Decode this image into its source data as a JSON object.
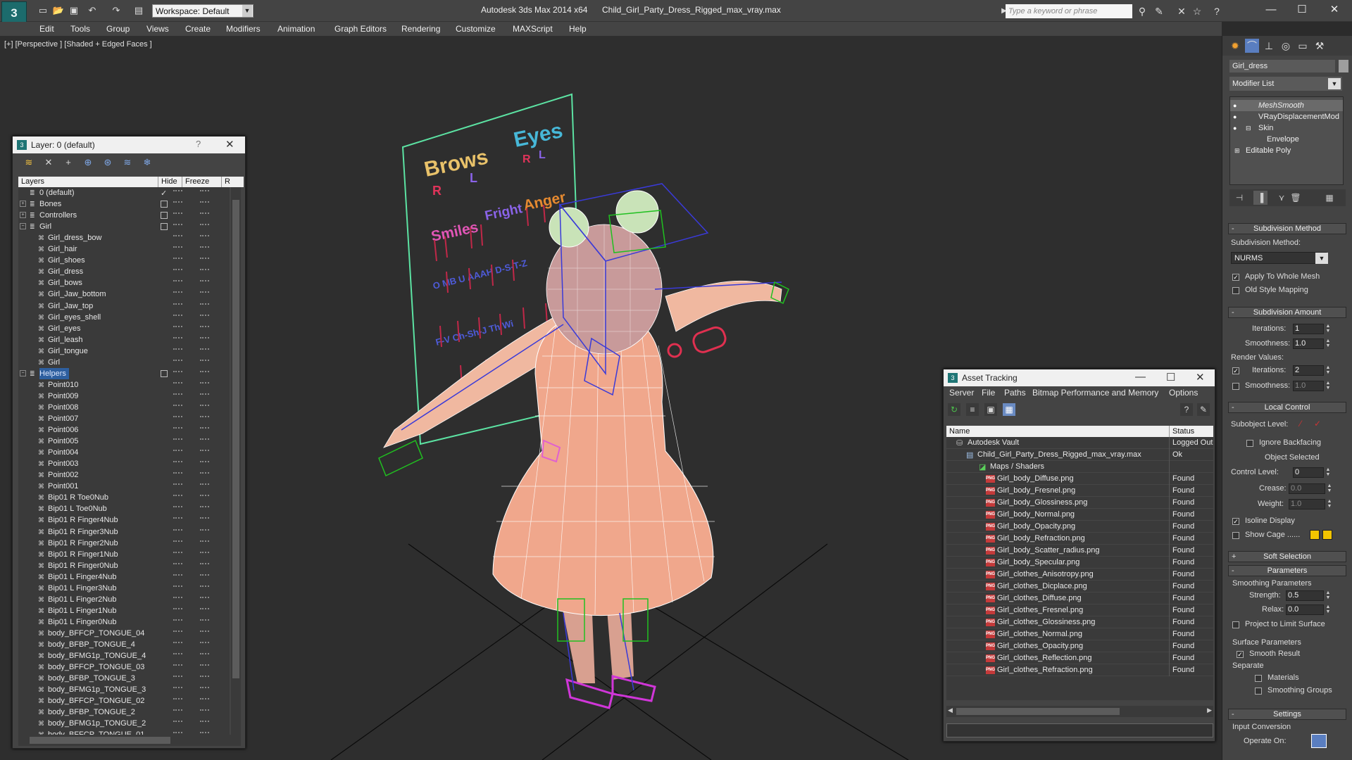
{
  "titlebar": {
    "workspace": "Workspace: Default",
    "app_name": "Autodesk 3ds Max  2014 x64",
    "file_name": "Child_Girl_Party_Dress_Rigged_max_vray.max",
    "search_placeholder": "Type a keyword or phrase"
  },
  "menu": [
    "Edit",
    "Tools",
    "Group",
    "Views",
    "Create",
    "Modifiers",
    "Animation",
    "Graph Editors",
    "Rendering",
    "Customize",
    "MAXScript",
    "Help"
  ],
  "viewport": {
    "label": "[+] [Perspective ] [Shaded + Edged Faces ]",
    "board_labels": {
      "brows": "Brows",
      "eyes": "Eyes",
      "r1": "R",
      "l1": "L",
      "r2": "R",
      "l2": "L",
      "smiles": "Smiles",
      "fright": "Fright",
      "anger": "Anger",
      "row3": "O  MB  U    AAAH  D-S-T-Z",
      "row4": "F-V  Ch-Sh-J  Th  Wi"
    }
  },
  "command_panel": {
    "object_name": "Girl_dress",
    "modifier_list_label": "Modifier List",
    "stack": [
      "MeshSmooth",
      "VRayDisplacementMod",
      "Skin",
      "Envelope",
      "Editable Poly"
    ],
    "rollouts": {
      "subdivision_method": "Subdivision Method",
      "subdivision_method_label": "Subdivision Method:",
      "method_value": "NURMS",
      "apply_whole_mesh": "Apply To Whole Mesh",
      "old_style_mapping": "Old Style Mapping",
      "subdivision_amount": "Subdivision Amount",
      "iterations_label": "Iterations:",
      "iterations_value": "1",
      "smoothness_label": "Smoothness:",
      "smoothness_value": "1.0",
      "render_values": "Render Values:",
      "render_iterations_label": "Iterations:",
      "render_iterations_value": "2",
      "render_smoothness_label": "Smoothness:",
      "render_smoothness_value": "1.0",
      "local_control": "Local Control",
      "subobject_level": "Subobject Level:",
      "ignore_backfacing": "Ignore Backfacing",
      "object_selected": "Object Selected",
      "control_level_label": "Control Level:",
      "control_level_value": "0",
      "crease_label": "Crease:",
      "crease_value": "0.0",
      "weight_label": "Weight:",
      "weight_value": "1.0",
      "isoline_display": "Isoline Display",
      "show_cage": "Show Cage ......",
      "soft_selection": "Soft Selection",
      "parameters": "Parameters",
      "smoothing_parameters": "Smoothing Parameters",
      "strength_label": "Strength:",
      "strength_value": "0.5",
      "relax_label": "Relax:",
      "relax_value": "0.0",
      "project_limit": "Project to Limit Surface",
      "surface_parameters": "Surface Parameters",
      "smooth_result": "Smooth Result",
      "separate": "Separate",
      "materials": "Materials",
      "smoothing_groups": "Smoothing Groups",
      "settings": "Settings",
      "input_conversion": "Input Conversion",
      "operate_on": "Operate On:"
    },
    "colors": {
      "cage_swatch": "#f2c400"
    }
  },
  "layer_panel": {
    "title": "Layer: 0 (default)",
    "help": "?",
    "columns": {
      "layers": "Layers",
      "hide": "Hide",
      "freeze": "Freeze",
      "render": "R"
    },
    "rows": [
      {
        "name": "0 (default)",
        "kind": "layer"
      },
      {
        "name": "Bones",
        "kind": "layer"
      },
      {
        "name": "Controllers",
        "kind": "layer"
      },
      {
        "name": "Girl",
        "kind": "layer"
      },
      {
        "name": "Girl_dress_bow",
        "kind": "obj"
      },
      {
        "name": "Girl_hair",
        "kind": "obj"
      },
      {
        "name": "Girl_shoes",
        "kind": "obj"
      },
      {
        "name": "Girl_dress",
        "kind": "obj"
      },
      {
        "name": "Girl_bows",
        "kind": "obj"
      },
      {
        "name": "Girl_Jaw_bottom",
        "kind": "obj"
      },
      {
        "name": "Girl_Jaw_top",
        "kind": "obj"
      },
      {
        "name": "Girl_eyes_shell",
        "kind": "obj"
      },
      {
        "name": "Girl_eyes",
        "kind": "obj"
      },
      {
        "name": "Girl_leash",
        "kind": "obj"
      },
      {
        "name": "Girl_tongue",
        "kind": "obj"
      },
      {
        "name": "Girl",
        "kind": "obj"
      },
      {
        "name": "Helpers",
        "kind": "layer"
      },
      {
        "name": "Point010",
        "kind": "obj"
      },
      {
        "name": "Point009",
        "kind": "obj"
      },
      {
        "name": "Point008",
        "kind": "obj"
      },
      {
        "name": "Point007",
        "kind": "obj"
      },
      {
        "name": "Point006",
        "kind": "obj"
      },
      {
        "name": "Point005",
        "kind": "obj"
      },
      {
        "name": "Point004",
        "kind": "obj"
      },
      {
        "name": "Point003",
        "kind": "obj"
      },
      {
        "name": "Point002",
        "kind": "obj"
      },
      {
        "name": "Point001",
        "kind": "obj"
      },
      {
        "name": "Bip01 R Toe0Nub",
        "kind": "obj"
      },
      {
        "name": "Bip01 L Toe0Nub",
        "kind": "obj"
      },
      {
        "name": "Bip01 R Finger4Nub",
        "kind": "obj"
      },
      {
        "name": "Bip01 R Finger3Nub",
        "kind": "obj"
      },
      {
        "name": "Bip01 R Finger2Nub",
        "kind": "obj"
      },
      {
        "name": "Bip01 R Finger1Nub",
        "kind": "obj"
      },
      {
        "name": "Bip01 R Finger0Nub",
        "kind": "obj"
      },
      {
        "name": "Bip01 L Finger4Nub",
        "kind": "obj"
      },
      {
        "name": "Bip01 L Finger3Nub",
        "kind": "obj"
      },
      {
        "name": "Bip01 L Finger2Nub",
        "kind": "obj"
      },
      {
        "name": "Bip01 L Finger1Nub",
        "kind": "obj"
      },
      {
        "name": "Bip01 L Finger0Nub",
        "kind": "obj"
      },
      {
        "name": "body_BFFCP_TONGUE_04",
        "kind": "obj"
      },
      {
        "name": "body_BFBP_TONGUE_4",
        "kind": "obj"
      },
      {
        "name": "body_BFMG1p_TONGUE_4",
        "kind": "obj"
      },
      {
        "name": "body_BFFCP_TONGUE_03",
        "kind": "obj"
      },
      {
        "name": "body_BFBP_TONGUE_3",
        "kind": "obj"
      },
      {
        "name": "body_BFMG1p_TONGUE_3",
        "kind": "obj"
      },
      {
        "name": "body_BFFCP_TONGUE_02",
        "kind": "obj"
      },
      {
        "name": "body_BFBP_TONGUE_2",
        "kind": "obj"
      },
      {
        "name": "body_BFMG1p_TONGUE_2",
        "kind": "obj"
      },
      {
        "name": "body_BFFCP_TONGUE_01",
        "kind": "obj"
      }
    ]
  },
  "asset_panel": {
    "title": "Asset Tracking",
    "menu": [
      "Server",
      "File",
      "Paths",
      "Bitmap Performance and Memory",
      "Options"
    ],
    "columns": {
      "name": "Name",
      "status": "Status"
    },
    "rows": [
      {
        "name": "Autodesk Vault",
        "status": "Logged Out",
        "level": 0,
        "kind": "vault"
      },
      {
        "name": "Child_Girl_Party_Dress_Rigged_max_vray.max",
        "status": "Ok",
        "level": 1,
        "kind": "max"
      },
      {
        "name": "Maps / Shaders",
        "status": "",
        "level": 2,
        "kind": "folder"
      },
      {
        "name": "Girl_body_Diffuse.png",
        "status": "Found",
        "level": 3,
        "kind": "png"
      },
      {
        "name": "Girl_body_Fresnel.png",
        "status": "Found",
        "level": 3,
        "kind": "png"
      },
      {
        "name": "Girl_body_Glossiness.png",
        "status": "Found",
        "level": 3,
        "kind": "png"
      },
      {
        "name": "Girl_body_Normal.png",
        "status": "Found",
        "level": 3,
        "kind": "png"
      },
      {
        "name": "Girl_body_Opacity.png",
        "status": "Found",
        "level": 3,
        "kind": "png"
      },
      {
        "name": "Girl_body_Refraction.png",
        "status": "Found",
        "level": 3,
        "kind": "png"
      },
      {
        "name": "Girl_body_Scatter_radius.png",
        "status": "Found",
        "level": 3,
        "kind": "png"
      },
      {
        "name": "Girl_body_Specular.png",
        "status": "Found",
        "level": 3,
        "kind": "png"
      },
      {
        "name": "Girl_clothes_Anisotropy.png",
        "status": "Found",
        "level": 3,
        "kind": "png"
      },
      {
        "name": "Girl_clothes_Dicplace.png",
        "status": "Found",
        "level": 3,
        "kind": "png"
      },
      {
        "name": "Girl_clothes_Diffuse.png",
        "status": "Found",
        "level": 3,
        "kind": "png"
      },
      {
        "name": "Girl_clothes_Fresnel.png",
        "status": "Found",
        "level": 3,
        "kind": "png"
      },
      {
        "name": "Girl_clothes_Glossiness.png",
        "status": "Found",
        "level": 3,
        "kind": "png"
      },
      {
        "name": "Girl_clothes_Normal.png",
        "status": "Found",
        "level": 3,
        "kind": "png"
      },
      {
        "name": "Girl_clothes_Opacity.png",
        "status": "Found",
        "level": 3,
        "kind": "png"
      },
      {
        "name": "Girl_clothes_Reflection.png",
        "status": "Found",
        "level": 3,
        "kind": "png"
      },
      {
        "name": "Girl_clothes_Refraction.png",
        "status": "Found",
        "level": 3,
        "kind": "png"
      }
    ]
  }
}
